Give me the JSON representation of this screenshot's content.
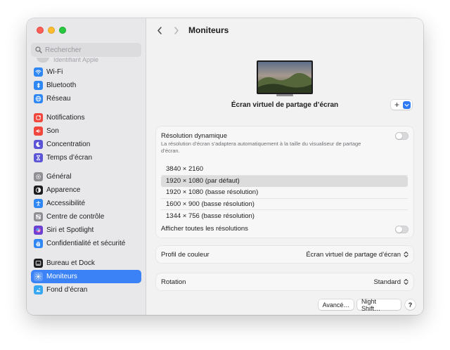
{
  "window": {
    "title": "Moniteurs"
  },
  "sidebar": {
    "search_placeholder": "Rechercher",
    "cut_item": "Identifiant Apple",
    "items": [
      {
        "label": "Wi-Fi",
        "icon": "wifi-icon",
        "color": "#2f86f5"
      },
      {
        "label": "Bluetooth",
        "icon": "bluetooth-icon",
        "color": "#2f86f5"
      },
      {
        "label": "Réseau",
        "icon": "network-globe-icon",
        "color": "#2f86f5"
      },
      {
        "label": "Notifications",
        "icon": "notifications-bell-icon",
        "color": "#f0463c"
      },
      {
        "label": "Son",
        "icon": "sound-speaker-icon",
        "color": "#f0463c"
      },
      {
        "label": "Concentration",
        "icon": "focus-moon-icon",
        "color": "#5b54d6"
      },
      {
        "label": "Temps d’écran",
        "icon": "screen-time-hourglass-icon",
        "color": "#5b54d6"
      },
      {
        "label": "Général",
        "icon": "general-gear-icon",
        "color": "#8e8e93"
      },
      {
        "label": "Apparence",
        "icon": "appearance-icon",
        "color": "#1d1d1f"
      },
      {
        "label": "Accessibilité",
        "icon": "accessibility-icon",
        "color": "#2f86f5"
      },
      {
        "label": "Centre de contrôle",
        "icon": "control-center-icon",
        "color": "#8e8e93"
      },
      {
        "label": "Siri et Spotlight",
        "icon": "siri-icon",
        "color": "#6a3fd1"
      },
      {
        "label": "Confidentialité et sécurité",
        "icon": "privacy-hand-icon",
        "color": "#2f86f5"
      },
      {
        "label": "Bureau et Dock",
        "icon": "desktop-dock-icon",
        "color": "#1d1d1f"
      },
      {
        "label": "Moniteurs",
        "icon": "displays-sun-icon",
        "color": "#2f86f5",
        "active": true
      },
      {
        "label": "Fond d’écran",
        "icon": "wallpaper-icon",
        "color": "#36a7f0"
      }
    ]
  },
  "main": {
    "title": "Moniteurs",
    "display_name": "Écran virtuel de partage d’écran",
    "add_button": "+",
    "resolution": {
      "dynamic_title": "Résolution dynamique",
      "dynamic_desc": "La résolution d’écran s’adaptera automatiquement à la taille du visualiseur de partage d’écran.",
      "dynamic_on": false,
      "options": [
        "3840 × 2160",
        "1920 × 1080 (par défaut)",
        "1920 × 1080 (basse résolution)",
        "1600 × 900 (basse résolution)",
        "1344 × 756 (basse résolution)"
      ],
      "selected_index": 1,
      "show_all_label": "Afficher toutes les résolutions",
      "show_all_on": false
    },
    "color_profile": {
      "label": "Profil de couleur",
      "value": "Écran virtuel de partage d’écran"
    },
    "rotation": {
      "label": "Rotation",
      "value": "Standard"
    },
    "buttons": {
      "advanced": "Avancé…",
      "night_shift": "Night Shift…",
      "help": "?"
    }
  },
  "colors": {
    "accent": "#3b82f6",
    "sidebar_bg": "#e8e7ea",
    "content_bg": "#f2f2f2"
  }
}
